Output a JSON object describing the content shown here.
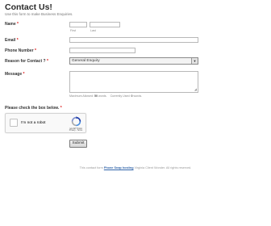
{
  "header": {
    "title": "Contact Us!",
    "subtitle": "Use this form to make Business Enquiries."
  },
  "form": {
    "name": {
      "label": "Name",
      "required_mark": "*",
      "first_sublabel": "First",
      "last_sublabel": "Last",
      "first_value": "",
      "last_value": ""
    },
    "email": {
      "label": "Email",
      "required_mark": "*",
      "value": ""
    },
    "phone": {
      "label": "Phone Number",
      "required_mark": "*",
      "value": ""
    },
    "reason": {
      "label": "Reason for Contact ?",
      "required_mark": "*",
      "selected": "General Enquiry"
    },
    "message": {
      "label": "Message",
      "required_mark": "*",
      "value": "",
      "max_label": "Maximum Allowed:",
      "max_value": "50",
      "max_unit": "words.",
      "current_label": "Currently Used:",
      "current_value": "0",
      "current_unit": "words."
    },
    "captcha": {
      "prompt": "Please check the box below.",
      "required_mark": "*",
      "checkbox_label": "I'm not a robot",
      "brand": "reCAPTCHA",
      "links": "Privacy - Terms"
    },
    "submit_label": "Submit"
  },
  "footer": {
    "prefix": "This contact form",
    "link_text": "Phone Snap hosting",
    "suffix": "Virginia Client Wonder. All rights reserved."
  },
  "colors": {
    "required": "#dd1111",
    "link": "#3366aa",
    "recaptcha_blue": "#1c3aa9",
    "recaptcha_lightblue": "#4a90e2",
    "recaptcha_gray": "#aaaaaa"
  }
}
